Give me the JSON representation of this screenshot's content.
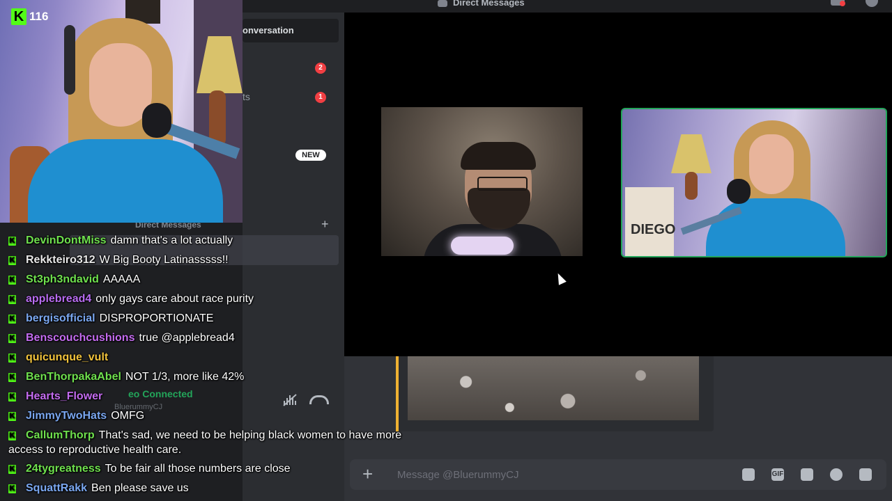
{
  "topbar": {
    "title": "Direct Messages"
  },
  "stream": {
    "viewer_count": "116",
    "kick_logo_letter": "K"
  },
  "sidebar": {
    "find_conversation": "onversation",
    "items": [
      {
        "label": "",
        "badge": "2"
      },
      {
        "label": "ts",
        "badge": "1"
      },
      {
        "label": "",
        "badge": "NEW"
      }
    ],
    "dm_header": "Direct Messages",
    "dm_add": "+"
  },
  "call": {
    "embed_description": "image attachment"
  },
  "voice_panel": {
    "status": "eo Connected",
    "user": "BluerummyCJ"
  },
  "composer": {
    "placeholder": "Message @BluerummyCJ",
    "plus": "+",
    "gif_label": "GIF"
  },
  "chat_overlay": {
    "messages": [
      {
        "user": "DevinDontMiss",
        "color": "#6fe04e",
        "text": "damn that's a lot actually"
      },
      {
        "user": "Rekkteiro312",
        "color": "#e8e8e8",
        "text": "W Big Booty Latinasssss!!"
      },
      {
        "user": "St3ph3ndavid",
        "color": "#6fe04e",
        "text": "AAAAA"
      },
      {
        "user": "applebread4",
        "color": "#b86cf0",
        "text": "only gays care about race purity"
      },
      {
        "user": "bergisofficial",
        "color": "#7aa7f0",
        "text": "DISPROPORTIONATE"
      },
      {
        "user": "Benscouchcushions",
        "color": "#c46cf0",
        "text": "true @applebread4"
      },
      {
        "user": "quicunque_vult",
        "color": "#f0c23c",
        "text": ""
      },
      {
        "user": "BenThorpakaAbel",
        "color": "#6fe04e",
        "text": "NOT 1/3, more like 42%"
      },
      {
        "user": "Hearts_Flower",
        "color": "#c46cf0",
        "text": ""
      },
      {
        "user": "JimmyTwoHats",
        "color": "#7aa7f0",
        "text": "OMFG"
      },
      {
        "user": "CallumThorp",
        "color": "#6fe04e",
        "text": "That's sad, we need to be helping black women to have more"
      },
      {
        "user": "24tygreatness",
        "color": "#6fe04e",
        "text": "To be fair all those numbers are close"
      },
      {
        "user": "SquattRakk",
        "color": "#7aa7f0",
        "text": "Ben please save us"
      }
    ],
    "wrap_text": "access to reproductive health care."
  },
  "colors": {
    "kick_green": "#53fc18",
    "discord_bg": "#313338",
    "speaking_green": "#23a55a",
    "embed_accent": "#f0b232"
  }
}
